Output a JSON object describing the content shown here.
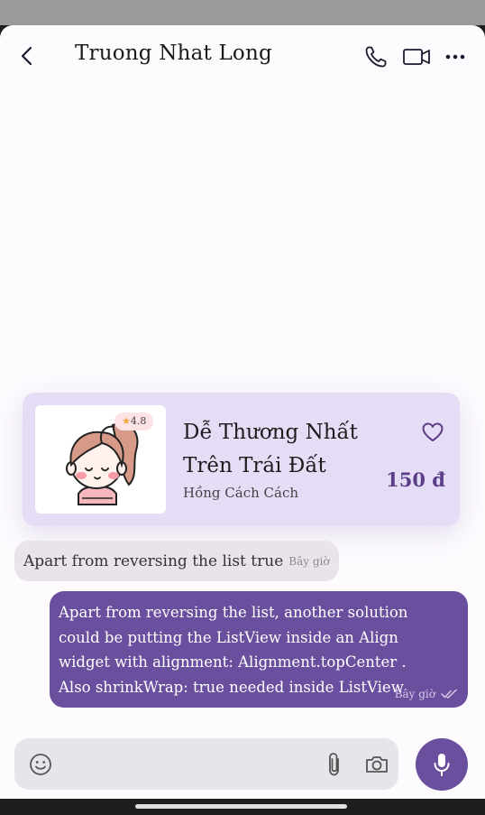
{
  "header": {
    "title": "Truong Nhat Long",
    "icons": [
      "back-icon",
      "phone-icon",
      "video-camera-icon",
      "more-icon"
    ]
  },
  "product": {
    "rating": "4.8",
    "name": "Dễ Thương Nhất Trên Trái Đất",
    "author": "Hồng Cách Cách",
    "price": "150 đ",
    "icons": [
      "heart-icon",
      "star-icon"
    ]
  },
  "messages": [
    {
      "direction": "incoming",
      "text": "Apart from reversing the list true",
      "time": "Bây giờ"
    },
    {
      "direction": "outgoing",
      "text": "Apart from reversing the list, another solution\ncould be putting the ListView inside an Align\nwidget with alignment: Alignment.topCenter .\nAlso shrinkWrap: true needed inside ListView",
      "time": "Bây giờ",
      "status_icon": "double-check-icon"
    }
  ],
  "composer": {
    "placeholder": "",
    "icons": [
      "emoji-icon",
      "paperclip-icon",
      "camera-icon",
      "microphone-icon"
    ]
  },
  "colors": {
    "accent": "#6a4f9e",
    "card_bg": "#e5dcf6",
    "incoming_bg": "#e9e4ec",
    "price": "#5b3d88"
  }
}
